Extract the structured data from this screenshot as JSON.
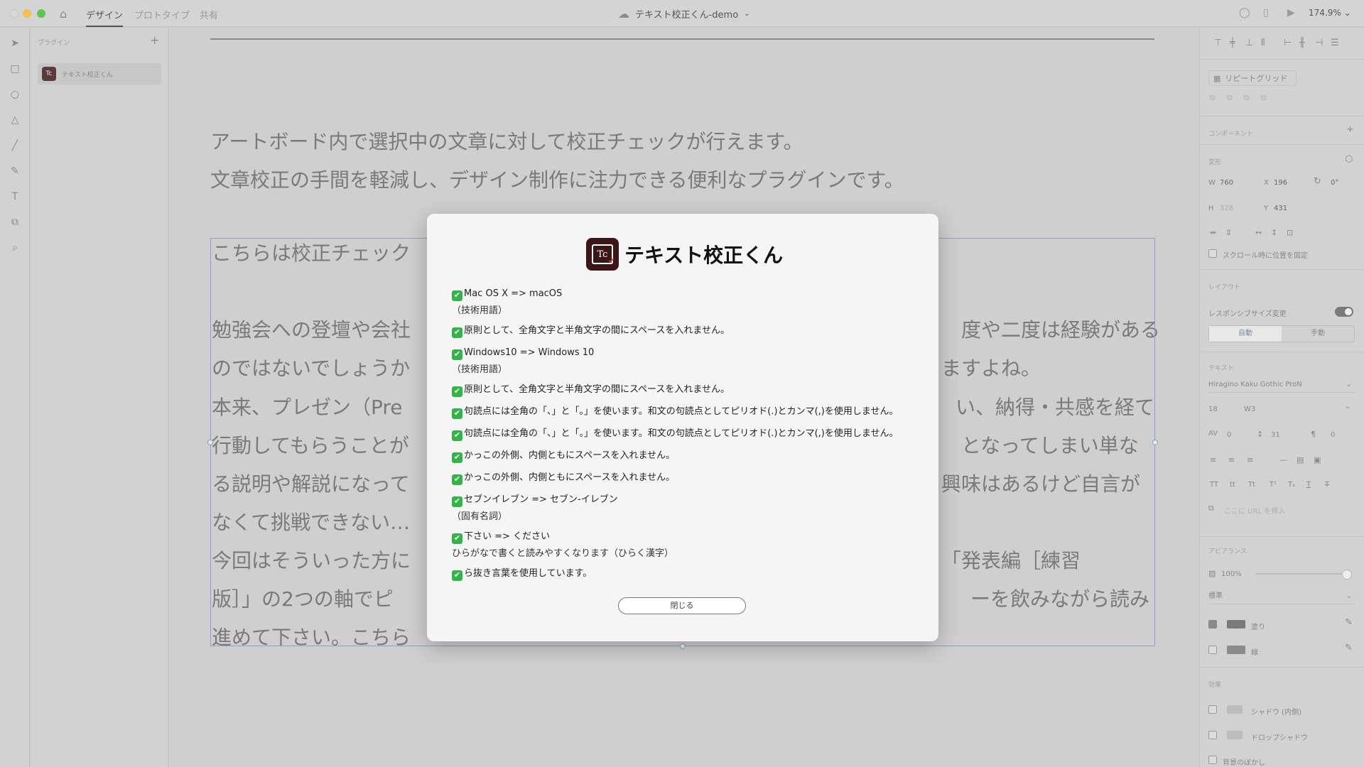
{
  "titlebar": {
    "tabs": [
      "デザイン",
      "プロトタイプ",
      "共有"
    ],
    "active_tab": "デザイン",
    "doc_title": "テキスト校正くん-demo",
    "zoom": "174.9%"
  },
  "plugin_panel": {
    "heading": "プラグイン",
    "item_label": "テキスト校正くん",
    "item_icon_text": "Tc"
  },
  "artboard": {
    "intro_line1": "アートボード内で選択中の文章に対して校正チェックが行えます。",
    "intro_line2": "文章校正の手間を軽減し、デザイン制作に注力できる便利なプラグインです。",
    "lines": [
      "こちらは校正チェック",
      "勉強会への登壇や会社",
      "度や二度は経験がある",
      "のではないでしょうか",
      "ますよね。",
      "本来、プレゼン（Pre",
      "い、納得・共感を経て",
      "行動してもらうことが",
      "となってしまい単な",
      "る説明や解説になって",
      "興味はあるけど自言が",
      "なくて挑戦できない…",
      "今回はそういった方に",
      "「発表編［練習",
      "版］」の2つの軸でピ",
      "ーを飲みながら読み",
      "進めて下さい。こちら"
    ]
  },
  "modal": {
    "icon_text": "Tc",
    "title": "テキスト校正くん",
    "items": [
      {
        "text": "Mac OS X => macOS",
        "sub": "（技術用語）"
      },
      {
        "text": "原則として、全角文字と半角文字の間にスペースを入れません。",
        "sub": ""
      },
      {
        "text": "Windows10 => Windows 10",
        "sub": "（技術用語）"
      },
      {
        "text": "原則として、全角文字と半角文字の間にスペースを入れません。",
        "sub": ""
      },
      {
        "text": "句読点には全角の「、」と「。」を使います。和文の句読点としてピリオド(.)とカンマ(,)を使用しません。",
        "sub": ""
      },
      {
        "text": "句読点には全角の「、」と「。」を使います。和文の句読点としてピリオド(.)とカンマ(,)を使用しません。",
        "sub": ""
      },
      {
        "text": "かっこの外側、内側ともにスペースを入れません。",
        "sub": ""
      },
      {
        "text": "かっこの外側、内側ともにスペースを入れません。",
        "sub": ""
      },
      {
        "text": "セブンイレブン => セブン-イレブン",
        "sub": "（固有名詞）"
      },
      {
        "text": "下さい => ください",
        "sub": "ひらがなで書くと読みやすくなります（ひらく漢字）"
      },
      {
        "text": "ら抜き言葉を使用しています。",
        "sub": ""
      }
    ],
    "close_label": "閉じる"
  },
  "right_panel": {
    "repeat_grid": "リピートグリッド",
    "component": "コンポーネント",
    "transform": "変形",
    "w_label": "W",
    "w_value": "760",
    "x_label": "X",
    "x_value": "196",
    "h_label": "H",
    "h_value": "328",
    "y_label": "Y",
    "y_value": "431",
    "rotation": "0°",
    "fix_scroll": "スクロール時に位置を固定",
    "layout": "レイアウト",
    "responsive": "レスポンシブサイズ変更",
    "seg_auto": "自動",
    "seg_manual": "手動",
    "text_section": "テキスト",
    "font_name": "Hiragino Kaku Gothic ProN",
    "font_size": "18",
    "font_weight": "W3",
    "tracking": "0",
    "line_height": "31",
    "para_spacing": "0",
    "url_placeholder": "ここに URL を挿入",
    "appearance": "アピアランス",
    "opacity": "100%",
    "blend": "標準",
    "fill": "塗り",
    "border": "線",
    "effects": "効果",
    "inner_shadow": "シャドウ (内側)",
    "drop_shadow": "ドロップシャドウ",
    "bg_blur": "背景のぼかし"
  }
}
